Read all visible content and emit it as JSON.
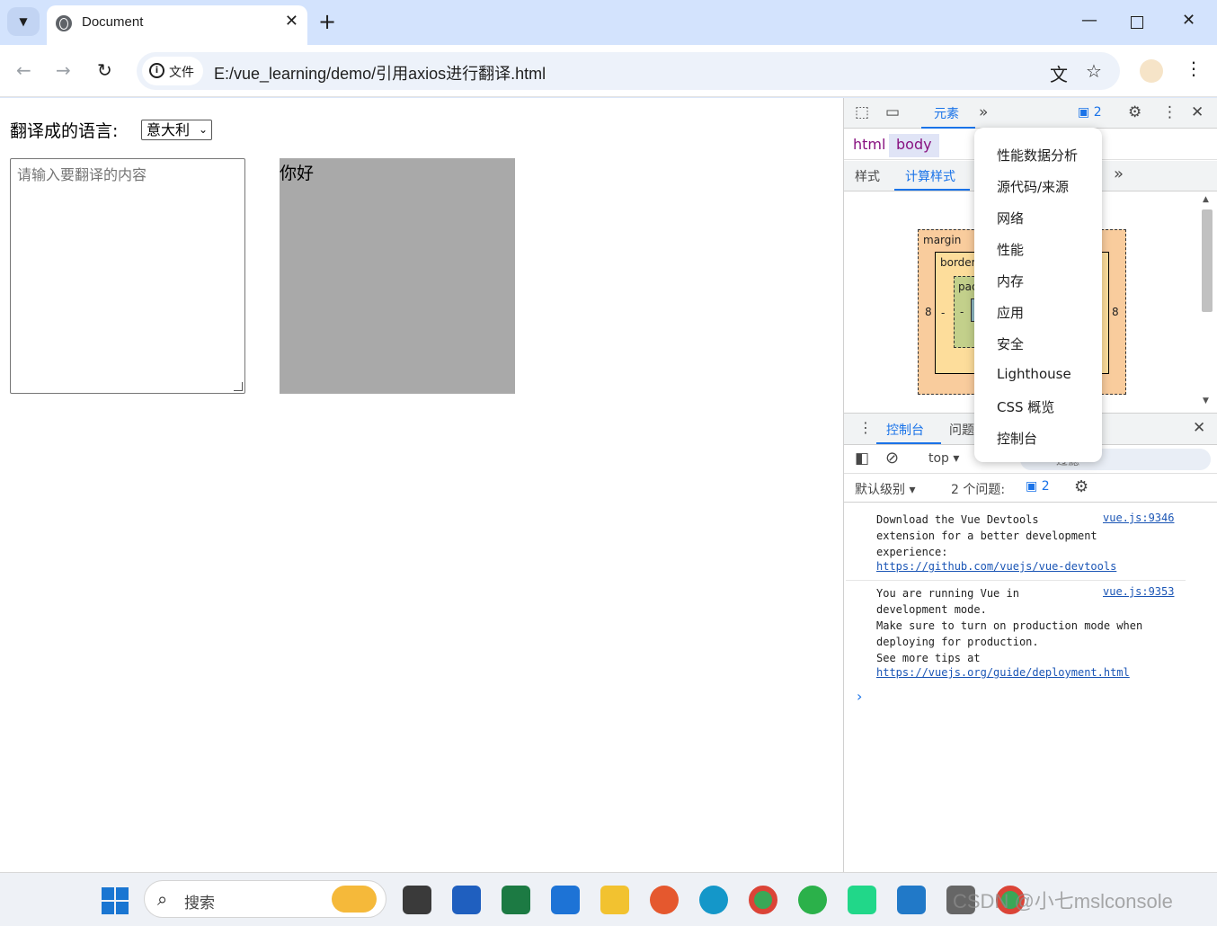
{
  "browser": {
    "tab_title": "Document",
    "new_tab": "+",
    "security_chip": "文件",
    "url": "E:/vue_learning/demo/引用axios进行翻译.html"
  },
  "page": {
    "language_label": "翻译成的语言:",
    "language_selected": "意大利",
    "input_placeholder": "请输入要翻译的内容",
    "output_text": "你好",
    "output_bg": "#a9a9a9"
  },
  "devtools": {
    "elements_tab": "元素",
    "issues_badge": "2",
    "breadcrumbs": [
      "html",
      "body"
    ],
    "subtabs": [
      "样式",
      "计算样式"
    ],
    "box_model": {
      "margin_label": "margin",
      "border_label": "border",
      "padding_label": "pac",
      "margin_left": "8",
      "margin_right": "8",
      "border_left": "-",
      "padding_left": "-"
    },
    "drawer_tabs": [
      "控制台",
      "问题"
    ],
    "context": "top",
    "filter_placeholder": "过滤",
    "level": "默认级别",
    "issues_label": "2 个问题:",
    "issues_count": "2",
    "console_messages": [
      {
        "text": "Download the Vue Devtools\nextension for a better development\nexperience:",
        "link": "https://github.com/vuejs/vue-devtools",
        "source": "vue.js:9346"
      },
      {
        "text": "You are running Vue in\ndevelopment mode.\nMake sure to turn on production mode when\ndeploying for production.\nSee more tips at",
        "link": "https://vuejs.org/guide/deployment.html",
        "source": "vue.js:9353"
      }
    ],
    "prompt": "›",
    "more_tools_menu": [
      "性能数据分析",
      "源代码/来源",
      "网络",
      "性能",
      "内存",
      "应用",
      "安全",
      "Lighthouse",
      "CSS 概览",
      "控制台"
    ]
  },
  "taskbar": {
    "search_text": "搜索"
  },
  "watermark": "CSDN @小七mslconsole",
  "colors": {
    "accent": "#1a73e8",
    "tab_strip": "#d3e3fd"
  }
}
